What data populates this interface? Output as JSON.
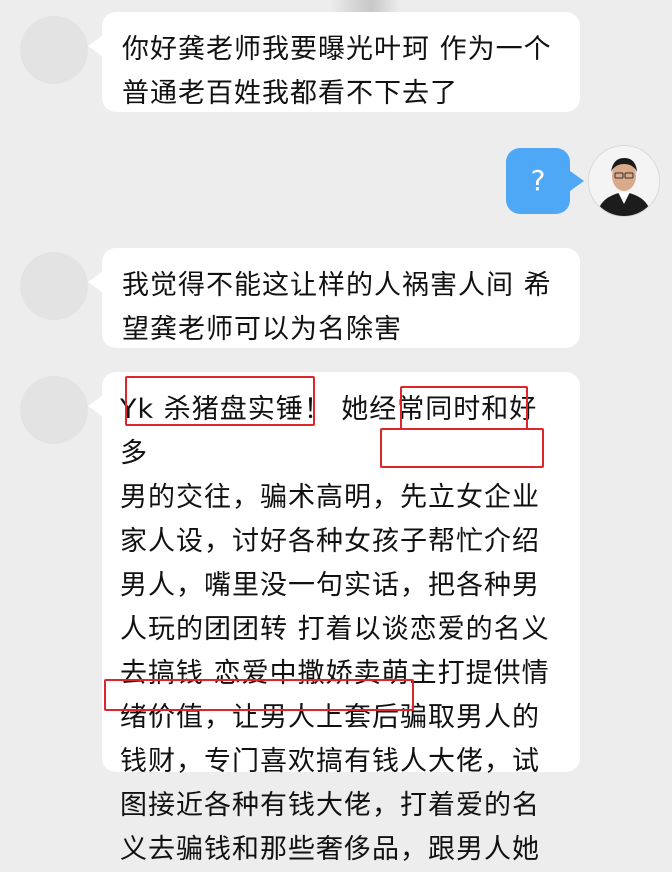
{
  "messages": [
    {
      "sender": "other",
      "lines": [
        "你好龚老师我要曝光叶珂 作为一个",
        "普通老百姓我都看不下去了"
      ]
    },
    {
      "sender": "me",
      "text": "?"
    },
    {
      "sender": "other",
      "lines": [
        "我觉得不能这让样的人祸害人间 希",
        "望龚老师可以为名除害"
      ]
    },
    {
      "sender": "other",
      "lines": [
        "Yk 杀猪盘实锤！ 她经常同时和好多",
        "男的交往，骗术高明，先立女企业",
        "家人设，讨好各种女孩子帮忙介绍",
        "男人，嘴里没一句实话，把各种男",
        "人玩的团团转 打着以谈恋爱的名义",
        "去搞钱 恋爱中撒娇卖萌主打提供情",
        "绪价值，让男人上套后骗取男人的",
        "钱财，专门喜欢搞有钱人大佬，试",
        "图接近各种有钱大佬，打着爱的名",
        "义去骗钱和那些奢侈品，跟男人她"
      ]
    }
  ],
  "colors": {
    "background": "#ededed",
    "bubble_other": "#ffffff",
    "bubble_me": "#4ea8f5",
    "highlight": "#e0242b"
  }
}
